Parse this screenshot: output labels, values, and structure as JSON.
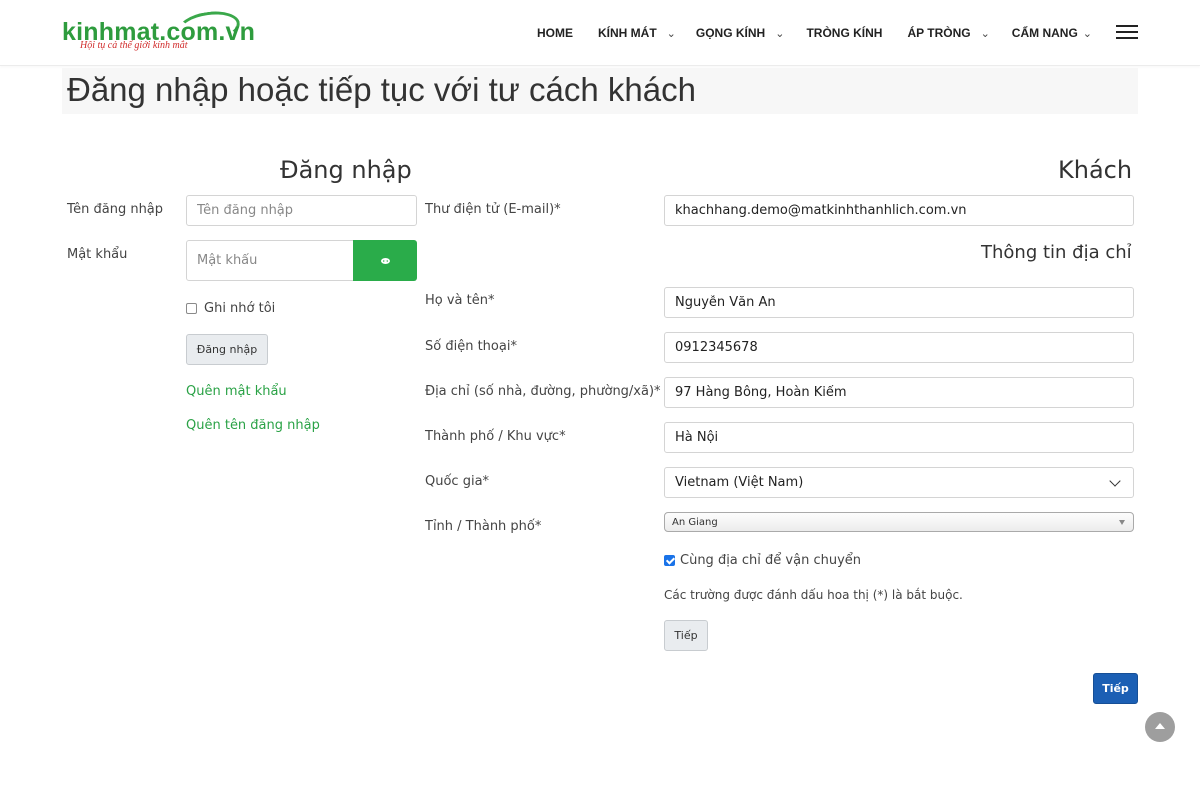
{
  "logo": {
    "text": "kinhmat.com.vn",
    "tagline": "Hội tụ cả thế giới kính mắt",
    "colors": {
      "main": "#2e9c3e",
      "tagline": "#d12c2c"
    }
  },
  "nav": {
    "items": [
      {
        "label": "HOME",
        "has_dropdown": false
      },
      {
        "label": "KÍNH MÁT",
        "has_dropdown": true
      },
      {
        "label": "GỌNG KÍNH",
        "has_dropdown": true
      },
      {
        "label": "TRÒNG KÍNH",
        "has_dropdown": false
      },
      {
        "label": "ÁP TRÒNG",
        "has_dropdown": true
      },
      {
        "label": "CẨM NANG",
        "has_dropdown": true
      }
    ],
    "chevron_glyph": "⌄",
    "menu_icon": "hamburger-icon"
  },
  "page": {
    "title": "Đăng nhập hoặc tiếp tục với tư cách khách"
  },
  "login": {
    "heading": "Đăng nhập",
    "username_label": "Tên đăng nhập",
    "username_placeholder": "Tên đăng nhập",
    "password_label": "Mật khẩu",
    "password_placeholder": "Mật khẩu",
    "show_password_icon": "eye-icon",
    "remember_label": "Ghi nhớ tôi",
    "remember_checked": false,
    "submit_label": "Đăng nhập",
    "forgot_password": "Quên mật khẩu",
    "forgot_username": "Quên tên đăng nhập"
  },
  "guest": {
    "heading": "Khách",
    "email_label": "Thư điện tử (E-mail)*",
    "email_value": "khachhang.demo@matkinhthanhlich.com.vn",
    "address_heading": "Thông tin địa chỉ",
    "fullname_label": "Họ và tên*",
    "fullname_value": "Nguyễn Văn An",
    "phone_label": "Số điện thoại*",
    "phone_value": "0912345678",
    "address_label": "Địa chỉ (số nhà, đường, phường/xã)*",
    "address_value": "97 Hàng Bông, Hoàn Kiếm",
    "city_label": "Thành phố / Khu vực*",
    "city_value": "Hà Nội",
    "country_label": "Quốc gia*",
    "country_value": "Vietnam (Việt Nam)",
    "province_label": "Tỉnh / Thành phố*",
    "province_value": "An Giang",
    "same_shipping_label": "Cùng địa chỉ để vận chuyển",
    "same_shipping_checked": true,
    "required_note": "Các trường được đánh dấu hoa thị (*) là bắt buộc.",
    "continue_label": "Tiếp",
    "continue_main_label": "Tiếp"
  },
  "colors": {
    "green": "#2aac4a",
    "link_green": "#2aa246",
    "blue_button": "#1b5fb4",
    "title_bar_bg": "#f7f7f7"
  }
}
